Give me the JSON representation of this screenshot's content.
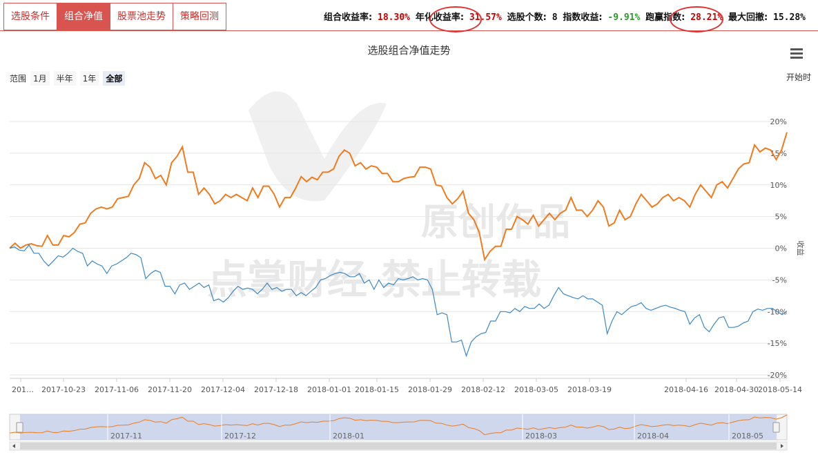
{
  "tabs": [
    {
      "label": "选股条件",
      "active": false
    },
    {
      "label": "组合净值",
      "active": true
    },
    {
      "label": "股票池走势",
      "active": false
    },
    {
      "label": "策略回测",
      "active": false
    }
  ],
  "stats": {
    "combo_return_label": "组合收益率:",
    "combo_return": "18.30%",
    "annual_label": "年化收益率:",
    "annual": "31.57%",
    "count_label": "选股个数:",
    "count": "8",
    "index_label": "指数收益:",
    "index": "-9.91%",
    "beat_label": "跑赢指数:",
    "beat": "28.21%",
    "drawdown_label": "最大回撤:",
    "drawdown": "15.28%"
  },
  "range": {
    "label": "范围",
    "buttons": [
      "1月",
      "半年",
      "1年",
      "全部"
    ],
    "selected": "全部",
    "start_label": "开始时"
  },
  "watermark": {
    "line1": "原创作品",
    "line2": "点掌财经 禁止转载"
  },
  "colors": {
    "portfolio": "#f07a1c",
    "index": "#3a87c4",
    "accent": "#d9534f"
  },
  "chart_data": {
    "type": "line",
    "title": "选股组合净值走势",
    "ylabel": "收益",
    "ylim": [
      -20,
      20
    ],
    "yticks": [
      20,
      15,
      10,
      5,
      0,
      -5,
      -10,
      -15,
      -20
    ],
    "ytick_labels": [
      "20%",
      "15%",
      "10%",
      "5%",
      "0%",
      "-5%",
      "-10%",
      "-15%",
      "-20%"
    ],
    "xtick_labels": [
      "201…",
      "2017-10-23",
      "2017-11-06",
      "2017-11-20",
      "2017-12-04",
      "2017-12-18",
      "2018-01-01",
      "2018-01-15",
      "2018-01-29",
      "2018-02-12",
      "2018-03-05",
      "2018-03-19",
      "2018-04-16",
      "2018-04-30",
      "2018-05-14"
    ],
    "navigator_labels": [
      "2017-11",
      "2017-12",
      "2018-01",
      "2018-03",
      "2018-04",
      "2018-05"
    ],
    "grid": true,
    "series": [
      {
        "values": [
          0,
          0.8,
          0,
          0.5,
          0.7,
          0.4,
          0.3,
          2,
          0.5,
          0.5,
          2,
          1.8,
          2.5,
          3.8,
          4,
          5.5,
          6.2,
          6.5,
          6.2,
          6.5,
          7.8,
          8,
          8.2,
          10,
          11,
          13.5,
          12.8,
          11,
          11.5,
          10,
          13.5,
          14.5,
          16,
          12,
          12,
          8.5,
          9.5,
          8.5,
          7,
          7.5,
          8.5,
          8,
          8.5,
          8,
          7.5,
          9.5,
          8,
          9.8,
          9.8,
          8.5,
          6.5,
          8,
          8,
          9.5,
          11.3,
          10.5,
          11.2,
          10.8,
          12,
          12,
          12.5,
          14.5,
          15.5,
          15,
          13,
          13.5,
          12.5,
          13,
          12.8,
          11.8,
          11.8,
          10.5,
          10.5,
          11,
          11.2,
          11.3,
          12.8,
          12.8,
          12.5,
          10,
          9.8,
          8,
          7,
          7.8,
          9,
          5.5,
          4.5,
          2.5,
          -1.8,
          -0.5,
          0.3,
          0.3,
          3,
          3,
          5,
          4.5,
          3.8,
          5.2,
          3.5,
          4.5,
          5.5,
          4.5,
          5.5,
          6,
          8,
          6,
          6,
          5,
          6,
          7.5,
          6.5,
          3.5,
          4,
          6,
          4.5,
          5,
          7,
          8.5,
          7.5,
          6.5,
          7,
          8,
          8.5,
          7.5,
          8,
          7.5,
          6.5,
          8.5,
          10,
          9,
          8,
          10,
          10.5,
          9.5,
          11,
          12.5,
          13.3,
          13.5,
          16.3,
          15.2,
          15.8,
          15.5,
          14,
          15.5,
          18.3
        ]
      },
      {
        "values": [
          0,
          0.2,
          -0.3,
          -0.4,
          0.5,
          -0.8,
          -0.8,
          -2,
          -2.8,
          -2,
          -1.2,
          -1.4,
          -0.8,
          0,
          -0.5,
          -0.8,
          -2.8,
          -2,
          -2.5,
          -2.8,
          -4,
          -2.8,
          -2.5,
          -2,
          -1.5,
          -0.8,
          -1,
          -1.5,
          -4.8,
          -4,
          -3.5,
          -3.8,
          -6,
          -6,
          -7.2,
          -5.8,
          -5.5,
          -6.5,
          -6,
          -5.5,
          -6.2,
          -5.8,
          -8.3,
          -8,
          -8.5,
          -7.8,
          -6.8,
          -6,
          -6.5,
          -6.3,
          -6.5,
          -7.2,
          -6.5,
          -5.5,
          -6.5,
          -6.2,
          -6.8,
          -6.5,
          -6.5,
          -7.5,
          -7,
          -7.5,
          -6.8,
          -6.2,
          -5,
          -4.8,
          -4.3,
          -4,
          -3.8,
          -4,
          -4.5,
          -4.5,
          -4,
          -5.5,
          -5,
          -6.5,
          -5,
          -6.2,
          -5.5,
          -5.8,
          -4.8,
          -5,
          -4.8,
          -4.5,
          -5,
          -4.8,
          -5,
          -6.5,
          -10.5,
          -10.2,
          -10.5,
          -14.8,
          -14.8,
          -14.5,
          -17,
          -14.8,
          -14,
          -13.5,
          -13.3,
          -11.5,
          -11.5,
          -10,
          -10,
          -10.2,
          -9.5,
          -10,
          -9.2,
          -9.5,
          -9.5,
          -8.8,
          -9.5,
          -9,
          -7.5,
          -6.2,
          -7.2,
          -7.5,
          -7.8,
          -8,
          -7.5,
          -8,
          -8,
          -8.5,
          -9,
          -13.5,
          -11.5,
          -10,
          -10.5,
          -9.8,
          -9.2,
          -9,
          -8.6,
          -9.5,
          -9.8,
          -9.5,
          -9.2,
          -9,
          -9.3,
          -9.5,
          -9.8,
          -10,
          -12,
          -11,
          -10.5,
          -12.5,
          -13.2,
          -12,
          -11,
          -10.8,
          -12.5,
          -12.5,
          -12.3,
          -11.8,
          -11.5,
          -10,
          -9.6,
          -9.8,
          -9.5,
          -9.5,
          -10,
          -10.5,
          -9.9
        ]
      }
    ]
  }
}
